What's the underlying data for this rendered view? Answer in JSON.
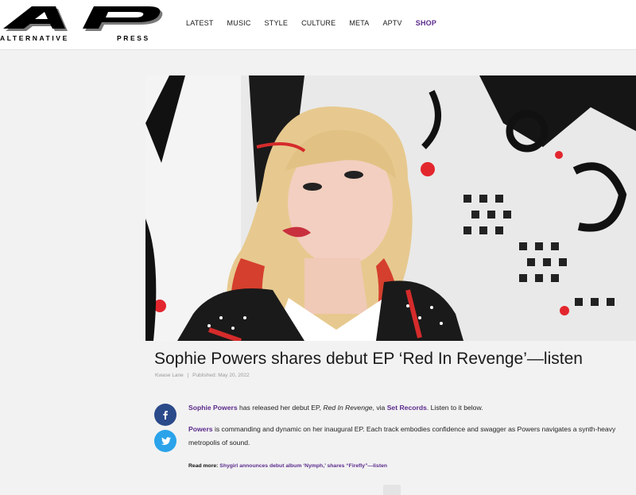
{
  "brand": {
    "logo_letters": "AP",
    "tagline_left": "ALTERNATIVE",
    "tagline_right": "PRESS"
  },
  "nav": {
    "items": [
      {
        "label": "LATEST"
      },
      {
        "label": "MUSIC"
      },
      {
        "label": "STYLE"
      },
      {
        "label": "CULTURE"
      },
      {
        "label": "META"
      },
      {
        "label": "APTV"
      },
      {
        "label": "SHOP"
      }
    ]
  },
  "article": {
    "title": "Sophie Powers shares debut EP ‘Red In Revenge’—listen",
    "author": "Kwase Lane",
    "separator": "|",
    "published": "Published: May 20, 2022",
    "p1": {
      "link1": "Sophie Powers",
      "text1": " has released her debut EP, ",
      "italic": "Red In Revenge",
      "text2": ", via ",
      "link2": "Set Records",
      "text3": ". Listen to it below."
    },
    "p2": {
      "link1": "Powers",
      "text1": " is commanding and dynamic on her inaugural EP. Each track embodies confidence and swagger as Powers navigates a synth-heavy metropolis of sound."
    },
    "read_more": {
      "label": "Read more: ",
      "link": "Shygirl announces debut album ‘Nymph,’ shares “Firefly”—listen"
    }
  },
  "share": {
    "facebook_icon": "facebook-icon",
    "twitter_icon": "twitter-icon"
  },
  "colors": {
    "accent": "#5b2b8c",
    "facebook": "#2b4a8a",
    "twitter": "#2aa3ea"
  }
}
